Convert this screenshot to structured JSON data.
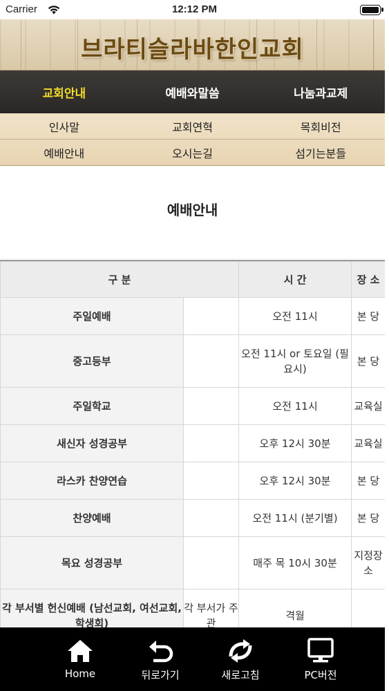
{
  "statusbar": {
    "carrier": "Carrier",
    "time": "12:12 PM",
    "battery_level": 1.0
  },
  "banner": {
    "title": "브라티슬라바한인교회"
  },
  "main_nav": [
    {
      "label": "교회안내",
      "active": true
    },
    {
      "label": "예배와말씀",
      "active": false
    },
    {
      "label": "나눔과교제",
      "active": false
    }
  ],
  "sub_nav": {
    "row1": [
      "인사말",
      "교회연혁",
      "목회비전"
    ],
    "row2": [
      "예배안내",
      "오시는길",
      "섬기는분들"
    ]
  },
  "page": {
    "title": "예배안내"
  },
  "table": {
    "headers": {
      "category": "구 분",
      "time": "시 간",
      "place": "장 소"
    },
    "rows": [
      {
        "name": "주일예배",
        "sub": "",
        "time": "오전 11시",
        "place": "본 당"
      },
      {
        "name": "중고등부",
        "sub": "",
        "time": "오전 11시 or 토요일 (필요시)",
        "place": "본 당"
      },
      {
        "name": "주일학교",
        "sub": "",
        "time": "오전 11시",
        "place": "교육실"
      },
      {
        "name": "새신자 성경공부",
        "sub": "",
        "time": "오후 12시 30분",
        "place": "교육실"
      },
      {
        "name": "라스카 찬양연습",
        "sub": "",
        "time": "오후 12시 30분",
        "place": "본 당"
      },
      {
        "name": "찬양예배",
        "sub": "",
        "time": "오전 11시 (분기별)",
        "place": "본 당"
      },
      {
        "name": "목요 성경공부",
        "sub": "",
        "time": "매주 목 10시 30분",
        "place": "지정장소"
      },
      {
        "name": "각 부서별 헌신예배 (남선교회, 여선교회, 학생회)",
        "sub": "각 부서가 주관",
        "time": "격월",
        "place": ""
      }
    ]
  },
  "toolbar": [
    {
      "label": "Home",
      "icon": "home-icon"
    },
    {
      "label": "뒤로가기",
      "icon": "back-arrow-icon"
    },
    {
      "label": "새로고침",
      "icon": "refresh-icon"
    },
    {
      "label": "PC버전",
      "icon": "monitor-icon"
    }
  ],
  "colors": {
    "nav_active": "#f3dc2a",
    "nav_bg": "#2f2c29",
    "banner_text": "#6b4a12",
    "subnav_bg": "#ecdbbc"
  }
}
